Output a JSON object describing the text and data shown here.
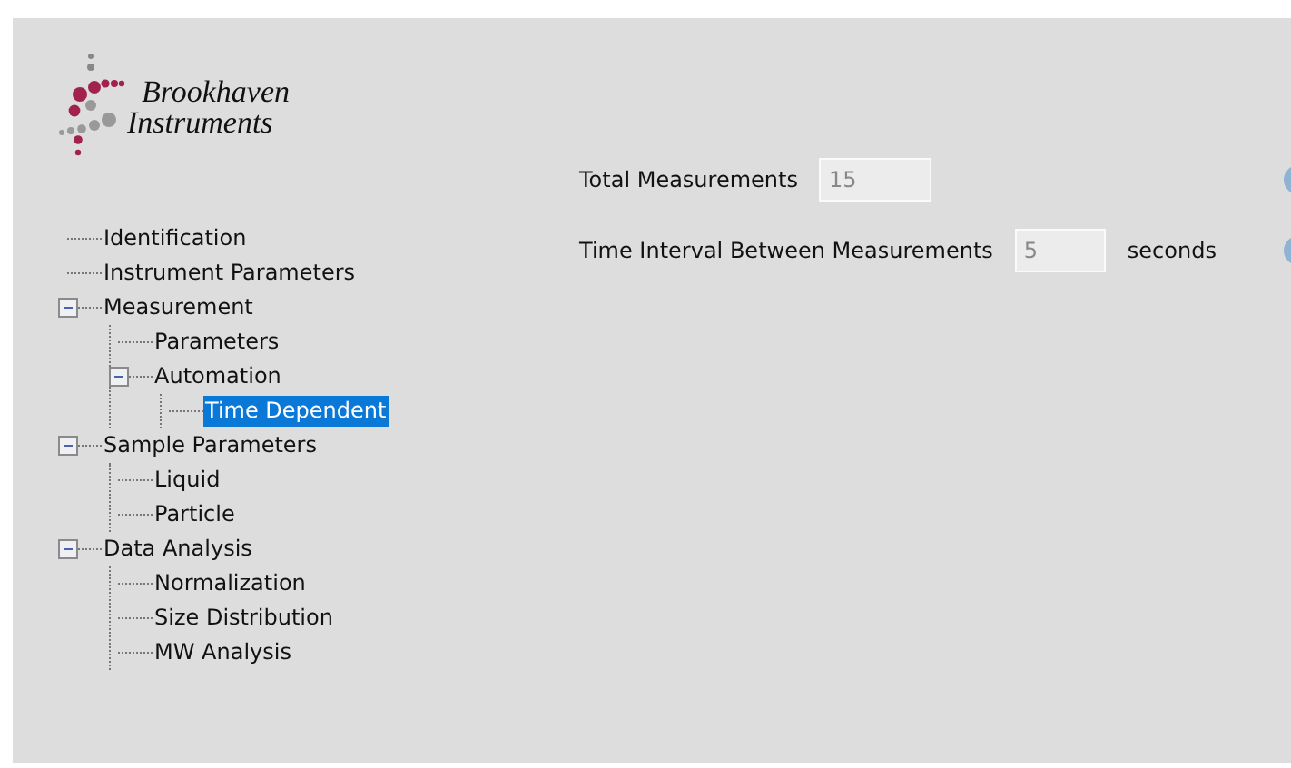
{
  "logo": {
    "lines": [
      "Brookhaven",
      "Instruments"
    ]
  },
  "tree": [
    {
      "label": "Identification",
      "selected": false
    },
    {
      "label": "Instrument Parameters",
      "selected": false
    },
    {
      "label": "Measurement",
      "selected": false,
      "expanded": true,
      "children": [
        {
          "label": "Parameters",
          "selected": false
        },
        {
          "label": "Automation",
          "selected": false,
          "expanded": true,
          "children": [
            {
              "label": "Time Dependent",
              "selected": true
            }
          ]
        }
      ]
    },
    {
      "label": "Sample Parameters",
      "selected": false,
      "expanded": true,
      "children": [
        {
          "label": "Liquid",
          "selected": false
        },
        {
          "label": "Particle",
          "selected": false
        }
      ]
    },
    {
      "label": "Data Analysis",
      "selected": false,
      "expanded": true,
      "children": [
        {
          "label": "Normalization",
          "selected": false
        },
        {
          "label": "Size Distribution",
          "selected": false
        },
        {
          "label": "MW Analysis",
          "selected": false
        }
      ]
    }
  ],
  "fields": [
    {
      "label": "Total Measurements",
      "value": "15",
      "disabled": true
    },
    {
      "label": "Time Interval Between Measurements",
      "value": "5",
      "unit": "seconds",
      "disabled": true
    }
  ]
}
